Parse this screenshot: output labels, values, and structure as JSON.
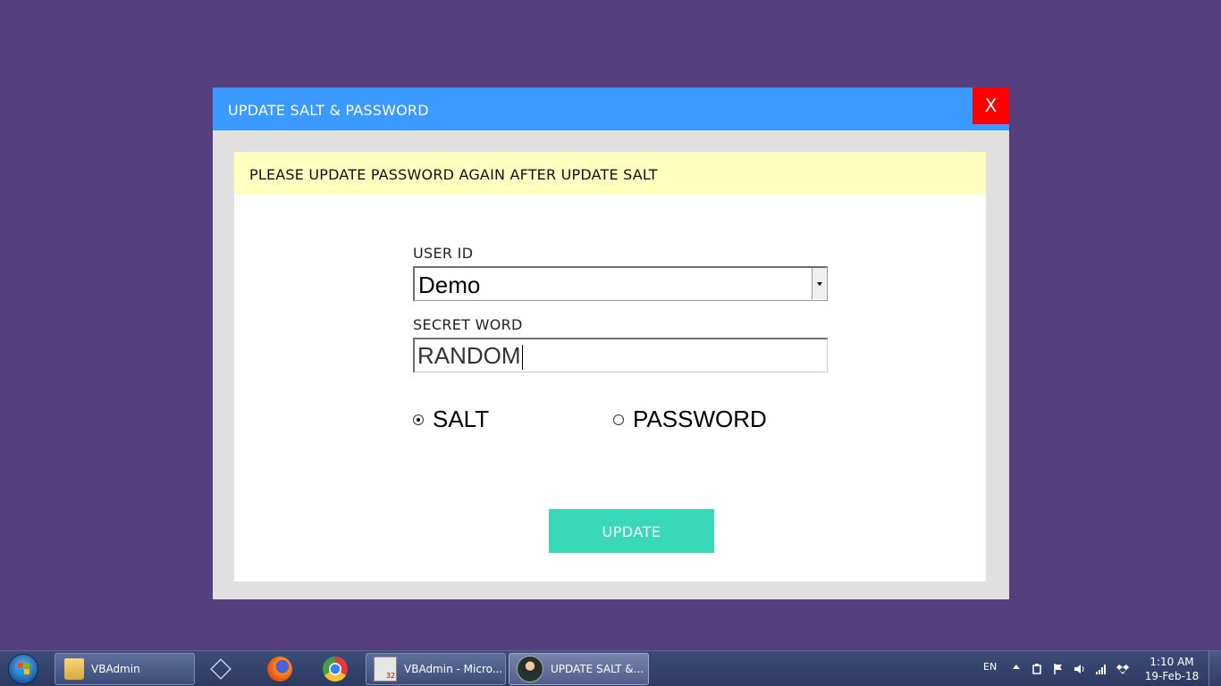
{
  "dialog": {
    "title": "UPDATE SALT & PASSWORD",
    "close_label": "X",
    "notice": "PLEASE UPDATE PASSWORD AGAIN AFTER UPDATE SALT",
    "user_id_label": "USER ID",
    "user_id_value": "Demo",
    "secret_word_label": "SECRET WORD",
    "secret_word_value": "RANDOM",
    "radio_options": [
      {
        "label": "SALT",
        "selected": true
      },
      {
        "label": "PASSWORD",
        "selected": false
      }
    ],
    "update_button": "UPDATE"
  },
  "taskbar": {
    "items": [
      {
        "icon": "folder-icon",
        "label": "VBAdmin"
      },
      {
        "icon": "virtualbox-icon",
        "label": ""
      },
      {
        "icon": "firefox-icon",
        "label": ""
      },
      {
        "icon": "chrome-icon",
        "label": ""
      },
      {
        "icon": "access-app-icon",
        "label": "VBAdmin - Micro..."
      },
      {
        "icon": "user-photo-icon",
        "label": "UPDATE SALT &..."
      }
    ],
    "language": "EN",
    "time": "1:10 AM",
    "date": "19-Feb-18"
  },
  "colors": {
    "desktop": "#553f7e",
    "titlebar": "#3a9aff",
    "close": "#ff0000",
    "notice_bg": "#ffffc0",
    "update_button": "#38d8b8"
  }
}
